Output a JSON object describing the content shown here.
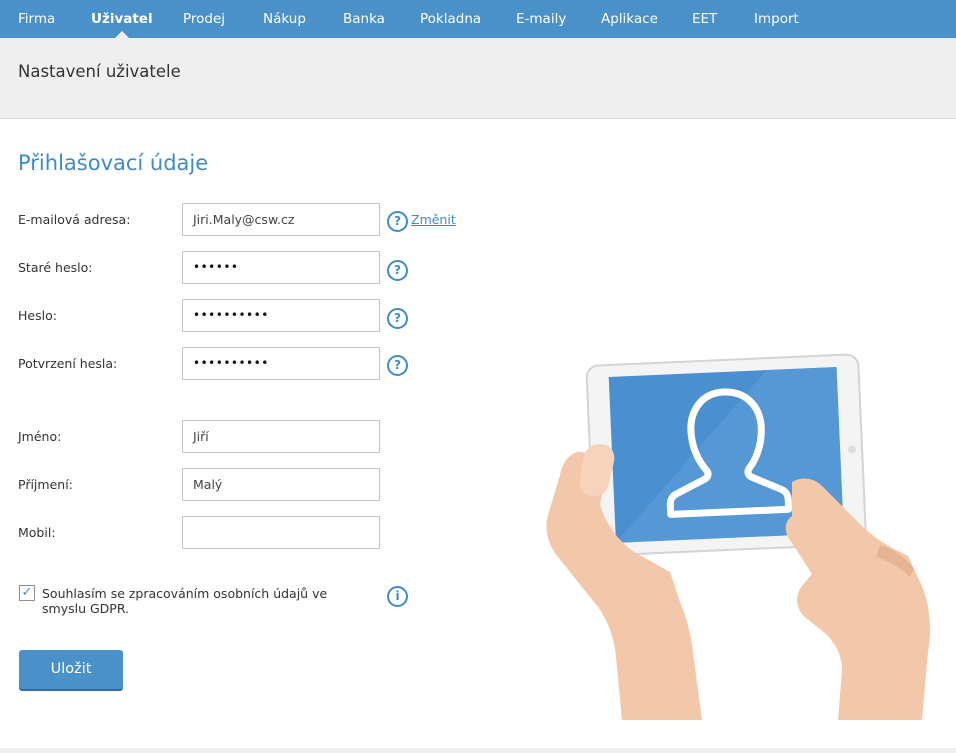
{
  "nav": {
    "items": [
      {
        "label": "Firma"
      },
      {
        "label": "Uživatel",
        "active": true
      },
      {
        "label": "Prodej"
      },
      {
        "label": "Nákup"
      },
      {
        "label": "Banka"
      },
      {
        "label": "Pokladna"
      },
      {
        "label": "E-maily"
      },
      {
        "label": "Aplikace"
      },
      {
        "label": "EET"
      },
      {
        "label": "Import"
      }
    ]
  },
  "page": {
    "title": "Nastavení uživatele"
  },
  "section": {
    "title": "Přihlašovací údaje"
  },
  "form": {
    "email": {
      "label": "E-mailová adresa:",
      "value": "Jiri.Maly@csw.cz",
      "change_link": "Změnit"
    },
    "old_password": {
      "label": "Staré heslo:",
      "value": "••••••"
    },
    "password": {
      "label": "Heslo:",
      "value": "••••••••••"
    },
    "password_confirm": {
      "label": "Potvrzení hesla:",
      "value": "••••••••••"
    },
    "first_name": {
      "label": "Jméno:",
      "value": "Jiří"
    },
    "last_name": {
      "label": "Příjmení:",
      "value": "Malý"
    },
    "mobile": {
      "label": "Mobil:",
      "value": ""
    },
    "gdpr": {
      "checked": true,
      "label": "Souhlasím se zpracováním osobních údajů ve smyslu GDPR."
    },
    "save_label": "Uložit"
  },
  "icons": {
    "help": "help-circle-icon",
    "info": "info-circle-icon",
    "check": "checkmark-icon"
  },
  "colors": {
    "accent": "#4a90c9",
    "title": "#3f8bc8",
    "header_bg": "#efefef"
  }
}
